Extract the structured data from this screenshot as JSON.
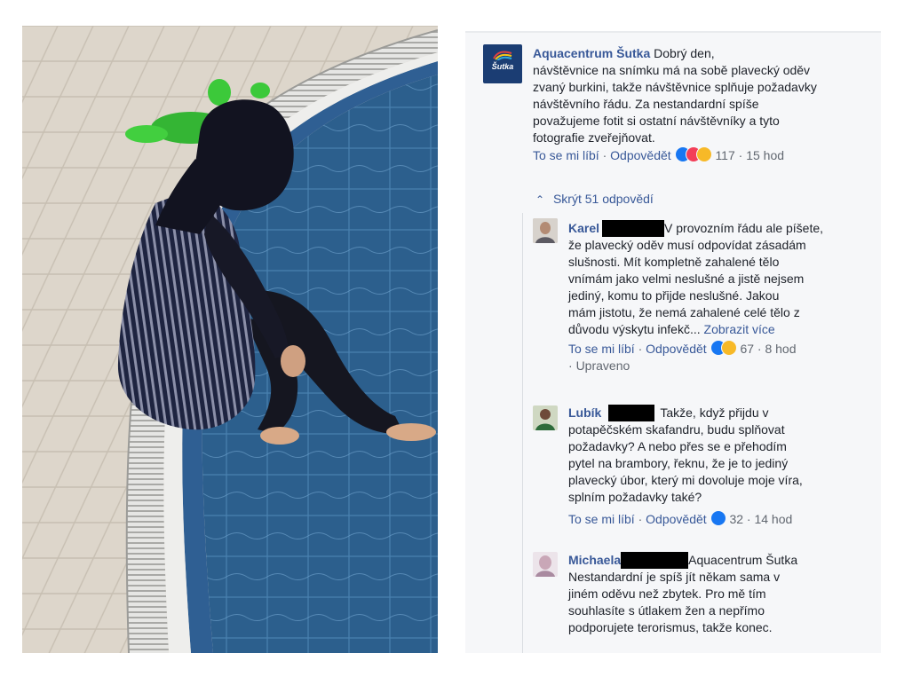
{
  "post": {
    "author": "Aquacentrum Šutka",
    "avatar_text": "Šutka",
    "lines": [
      "Dobrý den,",
      "návštěvnice na snímku má na sobě plavecký oděv",
      "zvaný burkini, takže návštěvnice splňuje požadavky",
      "návštěvního řádu. Za nestandardní spíše",
      "považujeme fotit si ostatní návštěvníky a tyto",
      "fotografie zveřejňovat."
    ],
    "like": "To se mi líbí",
    "reply": "Odpovědět",
    "reaction_count": "117",
    "time": "15 hod",
    "hide_replies": "Skrýt 51 odpovědí"
  },
  "replies": [
    {
      "author": "Karel",
      "lines": [
        "V provozním řádu ale píšete,",
        "že plavecký oděv musí odpovídat zásadám",
        "slušnosti. Mít kompletně zahalené tělo",
        "vnímám jako velmi neslušné a jistě nejsem",
        "jediný, komu to přijde neslušné. Jakou",
        "mám jistotu, že nemá zahalené celé tělo z",
        "důvodu výskytu infekč..."
      ],
      "see_more": "Zobrazit více",
      "like": "To se mi líbí",
      "reply": "Odpovědět",
      "reaction_count": "67",
      "time": "8 hod",
      "edited": "Upraveno"
    },
    {
      "author": "Lubík",
      "lines": [
        "Takže, když přijdu v",
        "potapěčském skafandru, budu splňovat",
        "požadavky? A nebo přes se e přehodím",
        "pytel na brambory, řeknu, že je to jediný",
        "plavecký úbor, který mi dovoluje moje víra,",
        "splním požadavky také?"
      ],
      "like": "To se mi líbí",
      "reply": "Odpovědět",
      "reaction_count": "32",
      "time": "14 hod"
    },
    {
      "author": "Michaela",
      "mention": "Aquacentrum Šutka",
      "lines": [
        "Nestandardní je spíš jít někam sama v",
        "jiném oděvu než zbytek. Pro mě tím",
        "souhlasíte s útlakem žen a nepřímo",
        "podporujete terorismus, takže konec."
      ]
    }
  ],
  "colors": {
    "link": "#385898",
    "text": "#1d2129",
    "meta": "#616770",
    "panel_bg": "#f6f7f9",
    "like_blue": "#1877f2",
    "haha_yellow": "#f7b928",
    "love_red": "#f33e58"
  }
}
